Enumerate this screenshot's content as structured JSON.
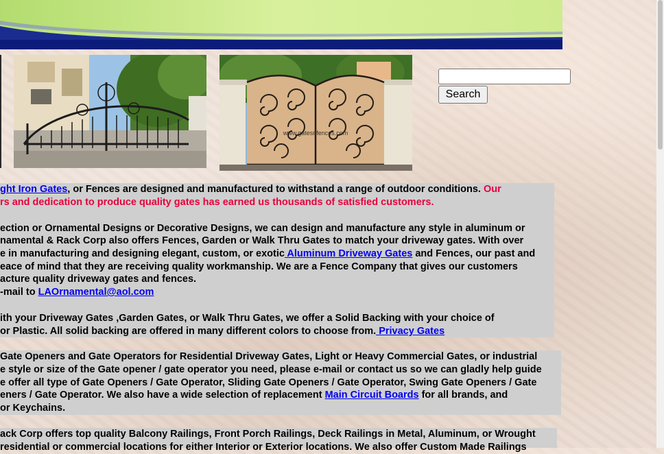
{
  "search": {
    "placeholder": "",
    "value": "",
    "button_label": "Search"
  },
  "photos": [
    {
      "name": "ornamental-driveway-gate-photo"
    },
    {
      "name": "scroll-design-gate-photo",
      "watermark": "www.gatesnfences.com"
    }
  ],
  "intro": {
    "line1_link": "ght Iron Gates",
    "line1_text": ", or Fences are designed and manufactured to withstand a range of outdoor conditions. ",
    "line1_red": "Our",
    "line2_red": "rs and dedication to produce quality gates has earned us thousands of satisfied customers.",
    "line3": "ection or Ornamental Designs or Decorative Designs, we can design and manufacture any style in aluminum or",
    "line4": "namental & Rack Corp also offers Fences, Garden or Walk Thru Gates to match your driveway  gates. With over",
    "line5_pre": "e in manufacturing and designing elegant, custom, or exotic",
    "line5_link": " Aluminum Driveway Gates",
    "line5_post": " and Fences, our past and",
    "line6": "eace of mind that they are receiving quality workmanship.  We are a Fence Company that gives our customers",
    "line7": "acture quality driveway gates and fences.",
    "line8_pre": "-mail to ",
    "line8_link": "LAOrnamental@aol.com",
    "line9": "ith your Driveway Gates ,Garden Gates, or Walk Thru Gates, we offer a Solid Backing with your choice of",
    "line10_pre": "or Plastic.  All solid backing are offered in many different colors to choose from.",
    "line10_link": " Privacy Gates"
  },
  "openers": {
    "line1": " Gate Openers and Gate Operators for Residential Driveway Gates, Light or Heavy Commercial Gates, or industrial",
    "line2": "e style or size of the Gate opener / gate operator  you need, please e-mail or contact us so we can gladly help guide",
    "line3": "e offer all type of Gate Openers / Gate Operator, Sliding Gate Openers / Gate Operator, Swing Gate Openers / Gate",
    "line4_pre": "eners / Gate Operator. We also have a wide selection of replacement ",
    "line4_link": "Main Circuit Boards",
    "line4_post": " for all brands, and",
    "line5": "or Keychains."
  },
  "railings": {
    "line1": "ack Corp offers top quality Balcony Railings, Front Porch Railings, Deck Railings in Metal, Aluminum, or Wrought",
    "line2": "residential or commercial locations for either Interior or Exterior locations. We also offer Custom Made Railings"
  },
  "colors": {
    "banner_navy": "#0b1c7a",
    "banner_green": "#c8e888",
    "panel_gray": "#cfcfcf",
    "link_blue": "#0000ee",
    "highlight_red": "#e8003d"
  }
}
